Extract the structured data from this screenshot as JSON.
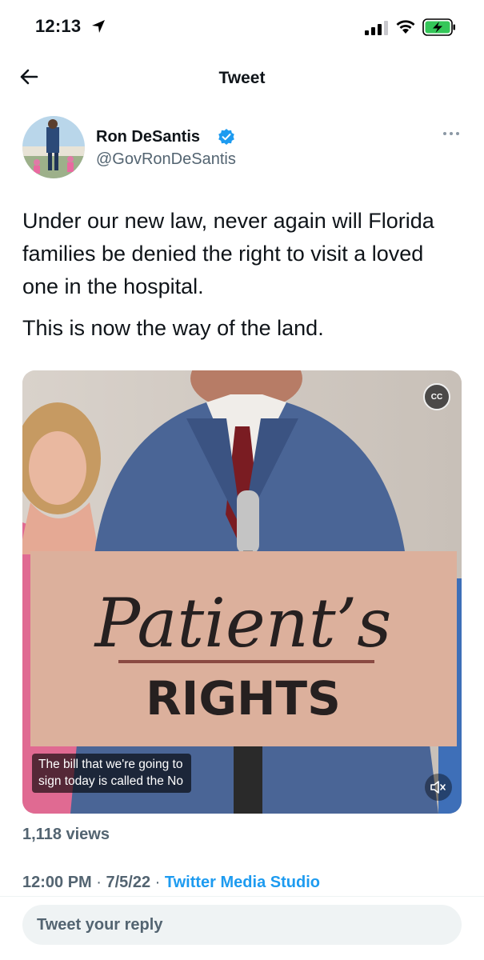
{
  "status_bar": {
    "time": "12:13"
  },
  "nav": {
    "title": "Tweet"
  },
  "author": {
    "name": "Ron DeSantis",
    "handle": "@GovRonDeSantis"
  },
  "tweet": {
    "paragraphs": [
      "Under our new law, never again will Florida families be denied the right to visit a loved one in the hospital.",
      "This is now the way of the land."
    ]
  },
  "media": {
    "sign_line1": "Patient’s",
    "sign_line2": "RIGHTS",
    "cc_label": "CC",
    "caption_line1": "The bill that we're going to",
    "caption_line2": "sign today is called the No"
  },
  "stats": {
    "views": "1,118 views"
  },
  "meta": {
    "time": "12:00 PM",
    "date": "7/5/22",
    "source": "Twitter Media Studio"
  },
  "reply": {
    "placeholder": "Tweet your reply"
  },
  "colors": {
    "accent": "#1d9bf0",
    "secondary_text": "#536471",
    "battery_green": "#34c759"
  }
}
